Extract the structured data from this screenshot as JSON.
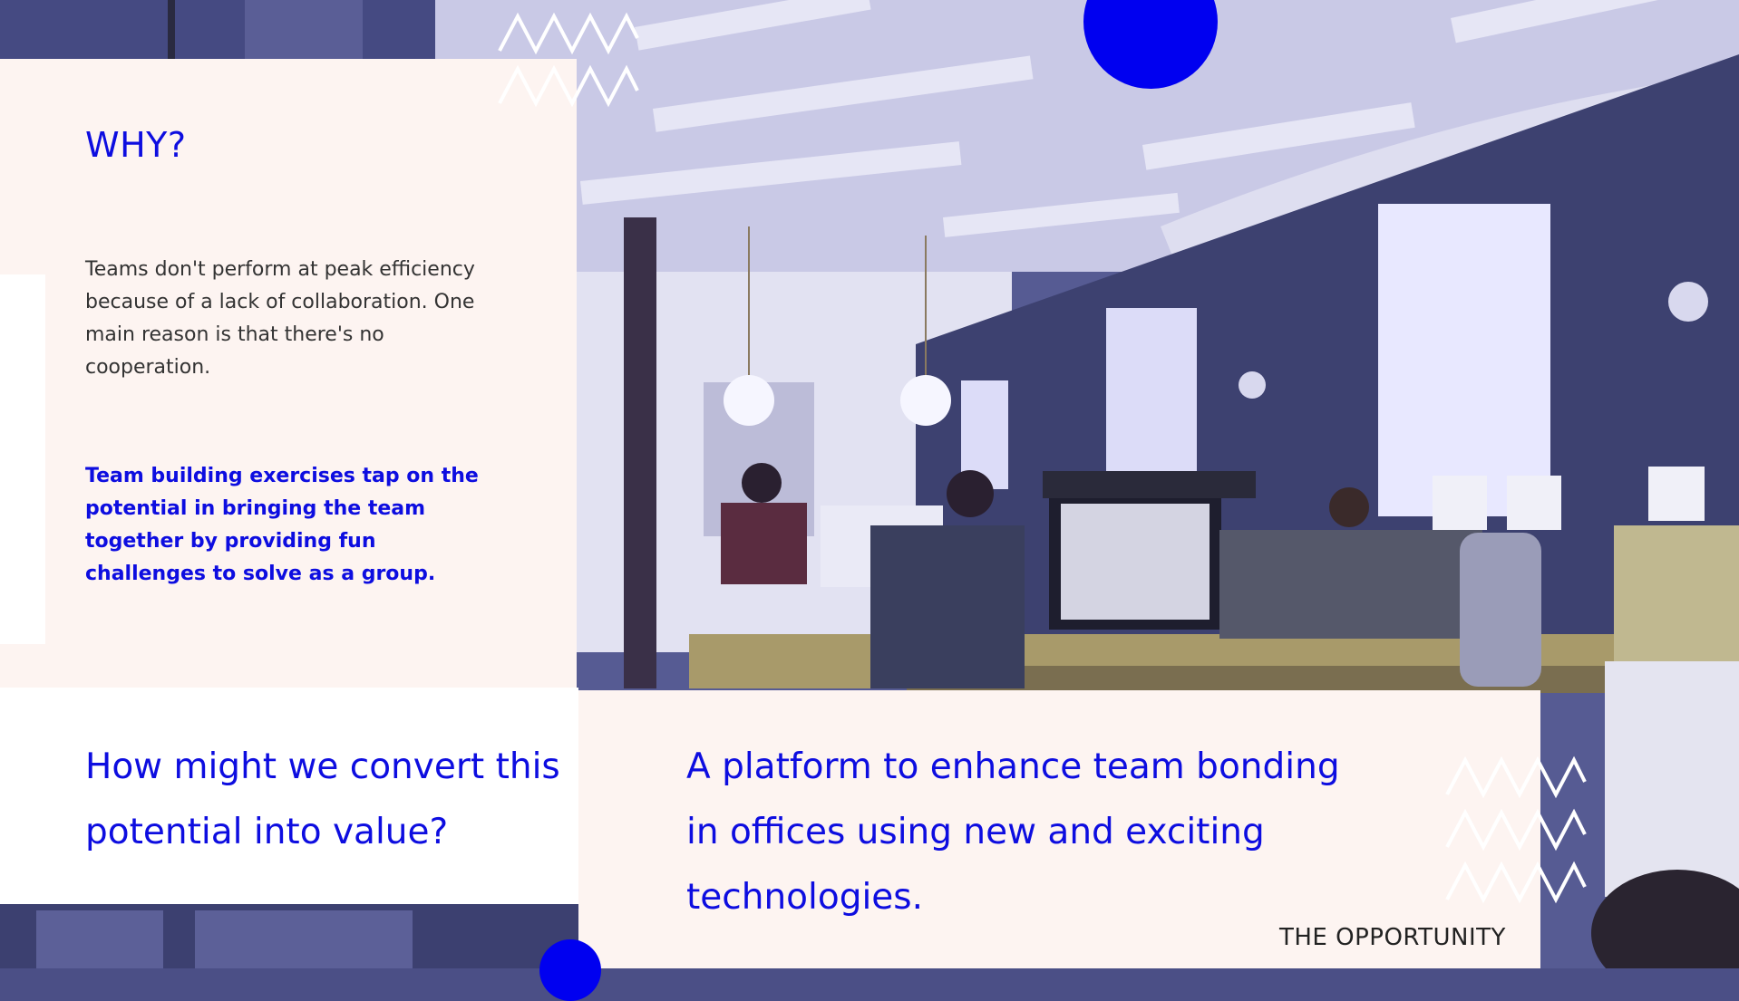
{
  "why": {
    "title": "WHY?",
    "body": "Teams don't perform at peak efficiency because of a lack of collaboration. One main reason is that there's no cooperation.",
    "highlight": "Team building exercises tap on the potential in bringing the team together by providing fun challenges to solve as a group."
  },
  "question": {
    "text": "How might we convert this potential into value?"
  },
  "answer": {
    "text": "A platform to enhance team bonding in offices using new and exciting technologies."
  },
  "footer": {
    "section_label": "THE OPPORTUNITY"
  },
  "colors": {
    "accent": "#0000f0",
    "heading_text": "#0d0de0",
    "panel_background": "#fdf4f1",
    "photo_tint": "#4b4f86"
  },
  "decorations": {
    "top_zigzag": "zigzag-pattern",
    "bottom_zigzag": "zigzag-pattern",
    "circles": "accent-circle"
  }
}
